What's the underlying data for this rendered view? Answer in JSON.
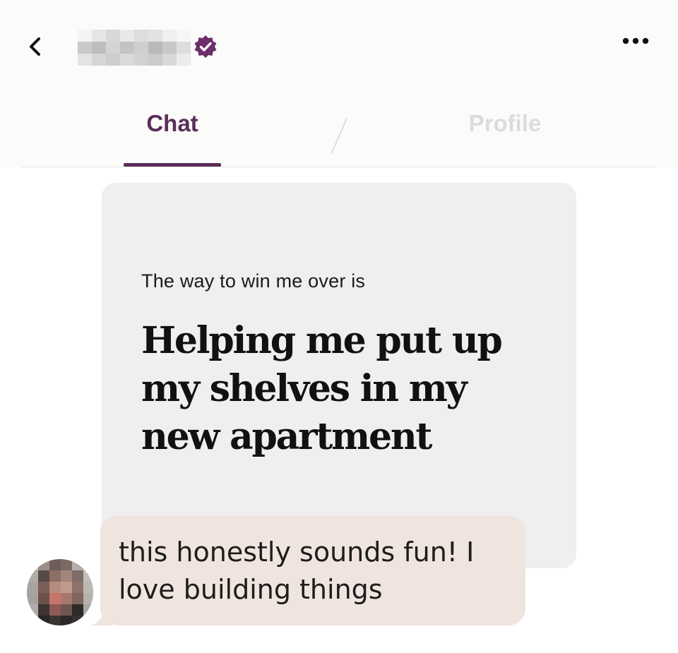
{
  "header": {
    "verified_color": "#6b2f6b",
    "back_icon": "chevron-left-icon",
    "more_icon": "more-horizontal-icon"
  },
  "tabs": [
    {
      "label": "Chat",
      "active": true
    },
    {
      "label": "Profile",
      "active": false
    }
  ],
  "colors": {
    "accent": "#5a2d58",
    "card_bg": "#efeff0",
    "reply_bg": "#f0e4de"
  },
  "prompt": {
    "question": "The way to win me over is",
    "answer": "Helping me put up my shelves in my new apartment"
  },
  "reply": {
    "text": "this honestly sounds fun!  I love building things"
  }
}
